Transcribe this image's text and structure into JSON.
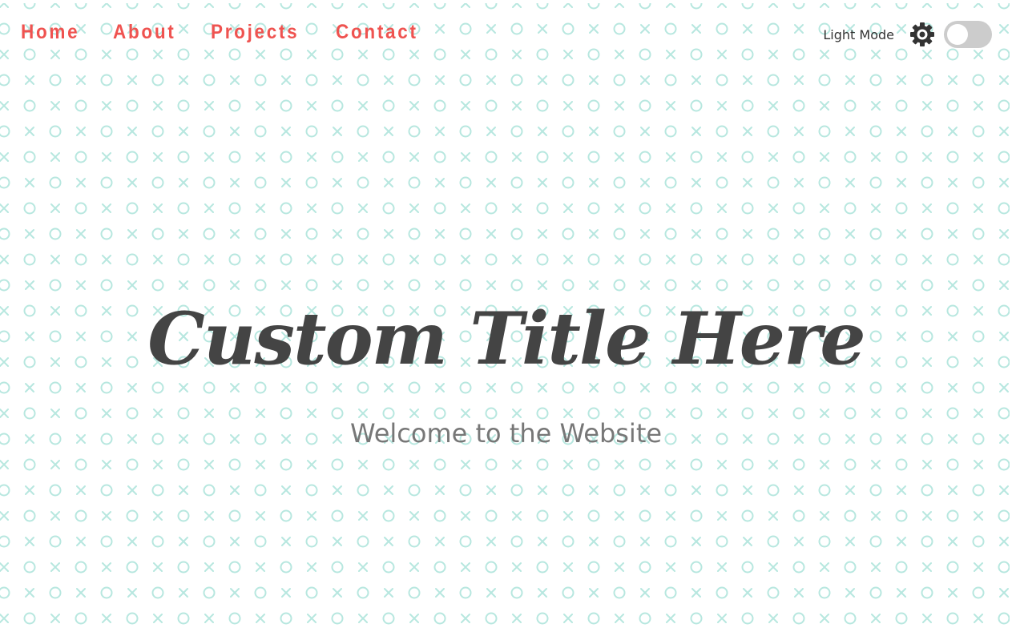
{
  "nav": {
    "items": [
      {
        "label": "Home"
      },
      {
        "label": "About"
      },
      {
        "label": "Projects"
      },
      {
        "label": "Contact"
      }
    ]
  },
  "theme": {
    "mode_label": "Light Mode",
    "toggle_on": false,
    "icon": "gear-icon"
  },
  "hero": {
    "title": "Custom Title Here",
    "subtitle": "Welcome to the Website"
  },
  "colors": {
    "nav_link": "#ef5350",
    "title": "#444444",
    "subtitle": "#777777",
    "pattern": "#b7e7df",
    "toggle_track": "#cccccc"
  }
}
